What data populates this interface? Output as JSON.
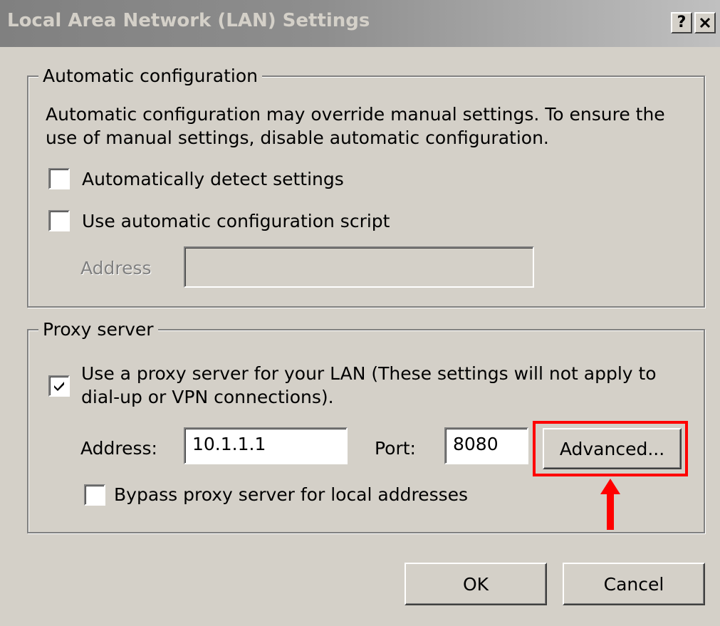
{
  "window": {
    "title": "Local Area Network (LAN) Settings",
    "help_button": "?",
    "close_button": "✕"
  },
  "auto_config": {
    "legend": "Automatic configuration",
    "description_line1": "Automatic configuration may override manual settings.  To ensure the",
    "description_line2": "use of manual settings, disable automatic configuration.",
    "detect_label": "Automatically detect settings",
    "detect_checked": false,
    "script_label": "Use automatic configuration script",
    "script_checked": false,
    "address_label": "Address",
    "address_value": ""
  },
  "proxy": {
    "legend": "Proxy server",
    "use_proxy_label_line1": "Use a proxy server for your LAN (These settings will not apply to",
    "use_proxy_label_line2": "dial-up or VPN connections).",
    "use_proxy_checked": true,
    "address_label": "Address:",
    "address_value": "10.1.1.1",
    "port_label": "Port:",
    "port_value": "8080",
    "advanced_label": "Advanced...",
    "bypass_label": "Bypass proxy server for local addresses",
    "bypass_checked": false
  },
  "footer": {
    "ok_label": "OK",
    "cancel_label": "Cancel"
  },
  "annotation": {
    "highlight_color": "#ff0000"
  }
}
